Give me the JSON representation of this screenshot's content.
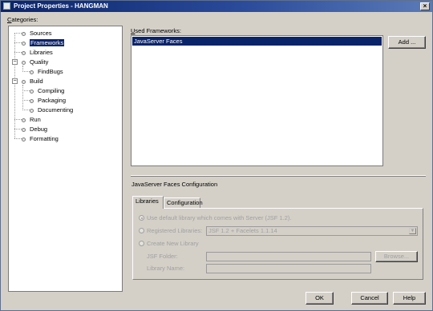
{
  "window": {
    "title": "Project Properties - HANGMAN",
    "close_glyph": "×"
  },
  "categories": {
    "label_u": "C",
    "label_rest": "ategories:",
    "items": [
      {
        "label": "Sources"
      },
      {
        "label": "Frameworks"
      },
      {
        "label": "Libraries"
      },
      {
        "label": "Quality"
      },
      {
        "label": "FindBugs"
      },
      {
        "label": "Build"
      },
      {
        "label": "Compiling"
      },
      {
        "label": "Packaging"
      },
      {
        "label": "Documenting"
      },
      {
        "label": "Run"
      },
      {
        "label": "Debug"
      },
      {
        "label": "Formatting"
      }
    ],
    "selected": "Frameworks"
  },
  "frameworks": {
    "label_u": "U",
    "label_rest": "sed Frameworks:",
    "items": [
      "JavaServer Faces"
    ],
    "add_button": "Add ..."
  },
  "config": {
    "section_title": "JavaServer Faces Configuration",
    "tabs": [
      "Libraries",
      "Configuration"
    ],
    "active_tab": "Libraries",
    "option_default": "Use default library which comes with Server (JSF 1.2).",
    "option_registered": "Registered Libraries:",
    "registered_value": "JSF 1.2 + Facelets 1.1.14",
    "option_create": "Create New Library",
    "jsf_folder_label": "JSF Folder:",
    "jsf_folder_value": "",
    "browse_button": "Browse...",
    "library_name_label": "Library Name:",
    "library_name_value": ""
  },
  "footer": {
    "ok": "OK",
    "cancel": "Cancel",
    "help": "Help"
  }
}
